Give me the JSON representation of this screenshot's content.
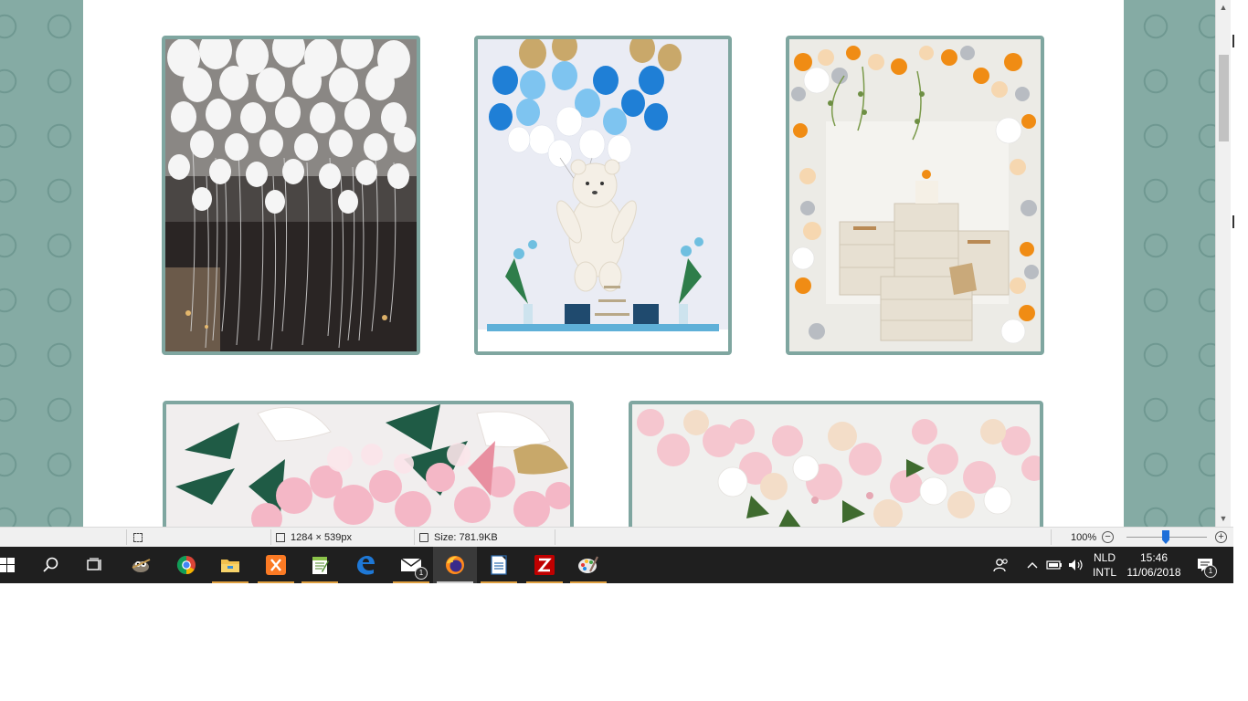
{
  "gallery": {
    "photos": [
      {
        "name": "white-balloons-ceiling-photo"
      },
      {
        "name": "teddy-bear-blue-balloons-photo"
      },
      {
        "name": "orange-balloon-arch-crates-photo"
      },
      {
        "name": "pink-balloons-palm-leaves-photo"
      },
      {
        "name": "pink-balloon-garland-photo"
      }
    ]
  },
  "statusbar": {
    "selection_icon": "selection-icon",
    "dimensions": "1284 × 539px",
    "size": "Size: 781.9KB",
    "zoom": "100%"
  },
  "taskbar": {
    "apps": [
      {
        "name": "start-button",
        "icon": "windows-logo-icon"
      },
      {
        "name": "search-button",
        "icon": "search-icon"
      },
      {
        "name": "task-view-button",
        "icon": "task-view-icon"
      },
      {
        "name": "gimp-app",
        "icon": "gimp-icon"
      },
      {
        "name": "chrome-app",
        "icon": "chrome-icon"
      },
      {
        "name": "file-explorer-app",
        "icon": "folder-icon"
      },
      {
        "name": "xampp-app",
        "icon": "xampp-icon"
      },
      {
        "name": "notepad-plus-app",
        "icon": "notepad-icon"
      },
      {
        "name": "edge-app",
        "icon": "edge-icon"
      },
      {
        "name": "mail-app",
        "icon": "mail-icon",
        "badge": "1"
      },
      {
        "name": "firefox-app",
        "icon": "firefox-icon"
      },
      {
        "name": "writer-app",
        "icon": "document-icon"
      },
      {
        "name": "filezilla-app",
        "icon": "filezilla-icon"
      },
      {
        "name": "paint-app",
        "icon": "paint-palette-icon"
      }
    ],
    "tray": {
      "language_top": "NLD",
      "language_bottom": "INTL",
      "time": "15:46",
      "date": "11/06/2018",
      "notifications_badge": "1"
    }
  },
  "colors": {
    "background_teal": "#85aba4",
    "frame_border": "#7fa6a0",
    "taskbar": "#1f1f1f"
  }
}
